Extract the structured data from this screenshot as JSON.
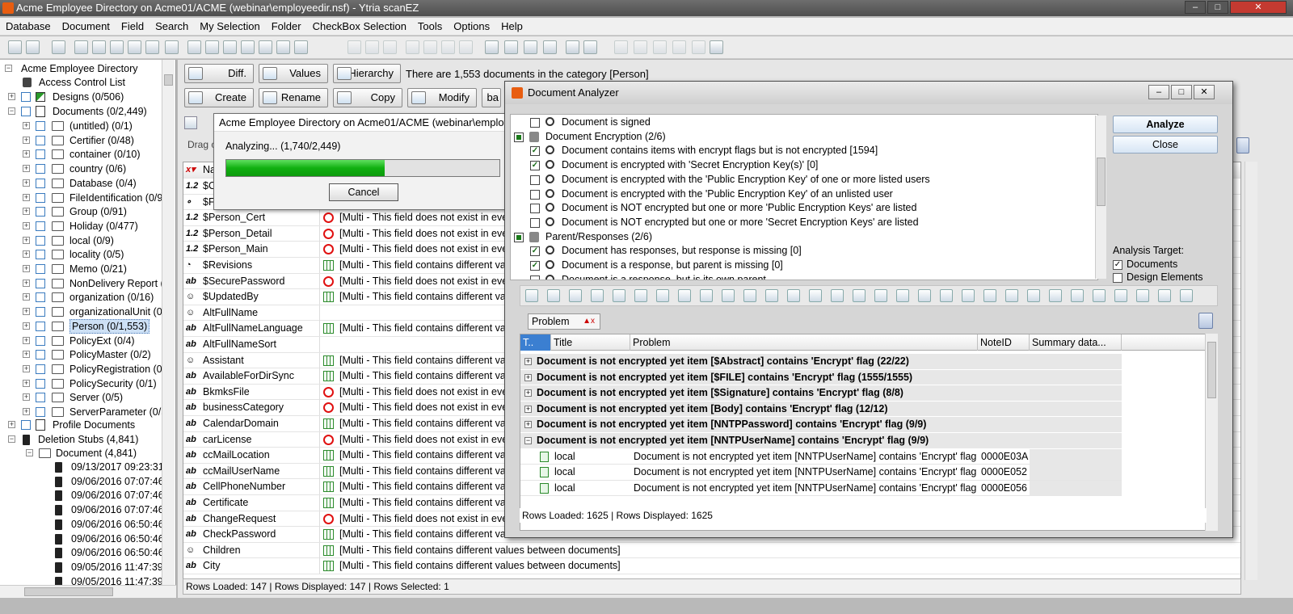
{
  "window": {
    "title": "Acme Employee Directory on Acme01/ACME (webinar\\employeedir.nsf) - Ytria scanEZ",
    "controls": [
      "–",
      "□",
      "✕"
    ]
  },
  "menu": [
    "Database",
    "Document",
    "Field",
    "Search",
    "My Selection",
    "Folder",
    "CheckBox Selection",
    "Tools",
    "Options",
    "Help"
  ],
  "tree": {
    "root": "Acme Employee Directory",
    "acl": "Access Control List",
    "designs": "Designs  (0/506)",
    "documents": "Documents  (0/2,449)",
    "folders": [
      "(untitled)  (0/1)",
      "Certifier  (0/48)",
      "container  (0/10)",
      "country  (0/6)",
      "Database  (0/4)",
      "FileIdentification  (0/9",
      "Group  (0/91)",
      "Holiday  (0/477)",
      "local  (0/9)",
      "locality  (0/5)",
      "Memo  (0/21)",
      "NonDelivery Report  (",
      "organization  (0/16)",
      "organizationalUnit  (0",
      "Person  (0/1,553)",
      "PolicyExt  (0/4)",
      "PolicyMaster  (0/2)",
      "PolicyRegistration  (0/",
      "PolicySecurity  (0/1)",
      "Server  (0/5)",
      "ServerParameter  (0/5"
    ],
    "profile": "Profile Documents",
    "stubs": "Deletion Stubs  (4,841)",
    "stub_doc": "Document  (4,841)",
    "stub_dates": [
      "09/13/2017 09:23:31 A",
      "09/06/2016 07:07:46 A",
      "09/06/2016 07:07:46 A",
      "09/06/2016 07:07:46 A",
      "09/06/2016 06:50:46 A",
      "09/06/2016 06:50:46 A",
      "09/06/2016 06:50:46 A",
      "09/05/2016 11:47:39 A",
      "09/05/2016 11:47:39 A"
    ]
  },
  "main": {
    "buttons": {
      "diff": "Diff.",
      "values": "Values",
      "hierarchy": "Hierarchy",
      "create": "Create",
      "rename": "Rename",
      "copy": "Copy",
      "modify": "Modify",
      "ba": "ba"
    },
    "category_info": "There are 1,553 documents in the category [Person]",
    "drag_hint": "Drag c",
    "name_col": "Na",
    "fields": [
      {
        "type": "1.2",
        "name": "$C",
        "icon": "",
        "value": ""
      },
      {
        "type": "∘",
        "name": "$F",
        "icon": "",
        "value": ""
      },
      {
        "type": "1.2",
        "name": "$Person_Cert",
        "icon": "no",
        "value": "[Multi - This field does not exist in every"
      },
      {
        "type": "1.2",
        "name": "$Person_Detail",
        "icon": "no",
        "value": "[Multi - This field does not exist in every"
      },
      {
        "type": "1.2",
        "name": "$Person_Main",
        "icon": "no",
        "value": "[Multi - This field does not exist in every"
      },
      {
        "type": "◔",
        "name": "$Revisions",
        "icon": "multi",
        "value": "[Multi - This field contains different valu"
      },
      {
        "type": "ab",
        "name": "$SecurePassword",
        "icon": "no",
        "value": "[Multi - This field does not exist in every"
      },
      {
        "type": "☺",
        "name": "$UpdatedBy",
        "icon": "multi",
        "value": "[Multi - This field contains different valu"
      },
      {
        "type": "☺",
        "name": "AltFullName",
        "icon": "",
        "value": ""
      },
      {
        "type": "ab",
        "name": "AltFullNameLanguage",
        "icon": "multi",
        "value": "[Multi - This field contains different valu"
      },
      {
        "type": "ab",
        "name": "AltFullNameSort",
        "icon": "",
        "value": ""
      },
      {
        "type": "☺",
        "name": "Assistant",
        "icon": "multi",
        "value": "[Multi - This field contains different valu"
      },
      {
        "type": "ab",
        "name": "AvailableForDirSync",
        "icon": "multi",
        "value": "[Multi - This field contains different valu"
      },
      {
        "type": "ab",
        "name": "BkmksFile",
        "icon": "no",
        "value": "[Multi - This field does not exist in every"
      },
      {
        "type": "ab",
        "name": "businessCategory",
        "icon": "no",
        "value": "[Multi - This field does not exist in every"
      },
      {
        "type": "ab",
        "name": "CalendarDomain",
        "icon": "multi",
        "value": "[Multi - This field contains different valu"
      },
      {
        "type": "ab",
        "name": "carLicense",
        "icon": "no",
        "value": "[Multi - This field does not exist in every"
      },
      {
        "type": "ab",
        "name": "ccMailLocation",
        "icon": "multi",
        "value": "[Multi - This field contains different valu"
      },
      {
        "type": "ab",
        "name": "ccMailUserName",
        "icon": "multi",
        "value": "[Multi - This field contains different valu"
      },
      {
        "type": "ab",
        "name": "CellPhoneNumber",
        "icon": "multi",
        "value": "[Multi - This field contains different valu"
      },
      {
        "type": "ab",
        "name": "Certificate",
        "icon": "multi",
        "value": "[Multi - This field contains different valu"
      },
      {
        "type": "ab",
        "name": "ChangeRequest",
        "icon": "no",
        "value": "[Multi - This field does not exist in every"
      },
      {
        "type": "ab",
        "name": "CheckPassword",
        "icon": "multi",
        "value": "[Multi - This field contains different valu"
      },
      {
        "type": "☺",
        "name": "Children",
        "icon": "multi",
        "value": "[Multi - This field contains different values between documents]"
      },
      {
        "type": "ab",
        "name": "City",
        "icon": "multi",
        "value": "[Multi - This field contains different values between documents]"
      }
    ],
    "status": "Rows Loaded: 147  |  Rows Displayed: 147  |  Rows Selected: 1"
  },
  "progress": {
    "title": "Acme Employee Directory on Acme01/ACME (webinar\\employeedir.nsf)",
    "text": "Analyzing... (1,740/2,449)",
    "fraction": 0.58,
    "cancel": "Cancel"
  },
  "analyzer": {
    "title": "Document Analyzer",
    "criteria": [
      {
        "text": "Document is signed",
        "checked": false,
        "level": 1
      },
      {
        "text": "Document Encryption  (2/6)",
        "checked": "partial",
        "level": 0
      },
      {
        "text": "Document contains items with encrypt flags but is not encrypted [1594]",
        "checked": true,
        "level": 1
      },
      {
        "text": "Document is encrypted with 'Secret Encryption Key(s)' [0]",
        "checked": true,
        "level": 1
      },
      {
        "text": "Document is encrypted with the 'Public Encryption Key' of one or more listed users",
        "checked": false,
        "level": 1
      },
      {
        "text": "Document is encrypted with the 'Public Encryption Key' of an unlisted user",
        "checked": false,
        "level": 1
      },
      {
        "text": "Document is NOT encrypted but one or more 'Public Encryption Keys' are listed",
        "checked": false,
        "level": 1
      },
      {
        "text": "Document is NOT encrypted but one or more 'Secret Encryption Keys' are listed",
        "checked": false,
        "level": 1
      },
      {
        "text": "Parent/Responses  (2/6)",
        "checked": "partial",
        "level": 0
      },
      {
        "text": "Document has responses, but response is missing [0]",
        "checked": true,
        "level": 1
      },
      {
        "text": "Document is a response, but parent is missing [0]",
        "checked": true,
        "level": 1
      },
      {
        "text": "Document is a response, but is its own parent",
        "checked": false,
        "level": 1
      }
    ],
    "analyze": "Analyze",
    "close": "Close",
    "target_label": "Analysis Target:",
    "targets": [
      {
        "label": "Documents",
        "checked": true
      },
      {
        "label": "Design Elements",
        "checked": false
      }
    ],
    "group_by": "Problem",
    "columns": {
      "t": "T..",
      "title": "Title",
      "problem": "Problem",
      "noteid": "NoteID",
      "summary": "Summary data..."
    },
    "groups": [
      "Document is not encrypted yet item [$Abstract] contains 'Encrypt' flag (22/22)",
      "Document is not encrypted yet item [$FILE] contains 'Encrypt' flag (1555/1555)",
      "Document is not encrypted yet item [$Signature] contains 'Encrypt' flag (8/8)",
      "Document is not encrypted yet item [Body] contains 'Encrypt' flag (12/12)",
      "Document is not encrypted yet item [NNTPPassword] contains 'Encrypt' flag (9/9)",
      "Document is not encrypted yet item [NNTPUserName] contains 'Encrypt' flag (9/9)"
    ],
    "rows": [
      {
        "title": "local",
        "problem": "Document is not encrypted yet item [NNTPUserName] contains 'Encrypt' flag",
        "noteid": "0000E03A"
      },
      {
        "title": "local",
        "problem": "Document is not encrypted yet item [NNTPUserName] contains 'Encrypt' flag",
        "noteid": "0000E052"
      },
      {
        "title": "local",
        "problem": "Document is not encrypted yet item [NNTPUserName] contains 'Encrypt' flag",
        "noteid": "0000E056"
      }
    ],
    "status": "Rows Loaded: 1625  |  Rows Displayed: 1625"
  }
}
